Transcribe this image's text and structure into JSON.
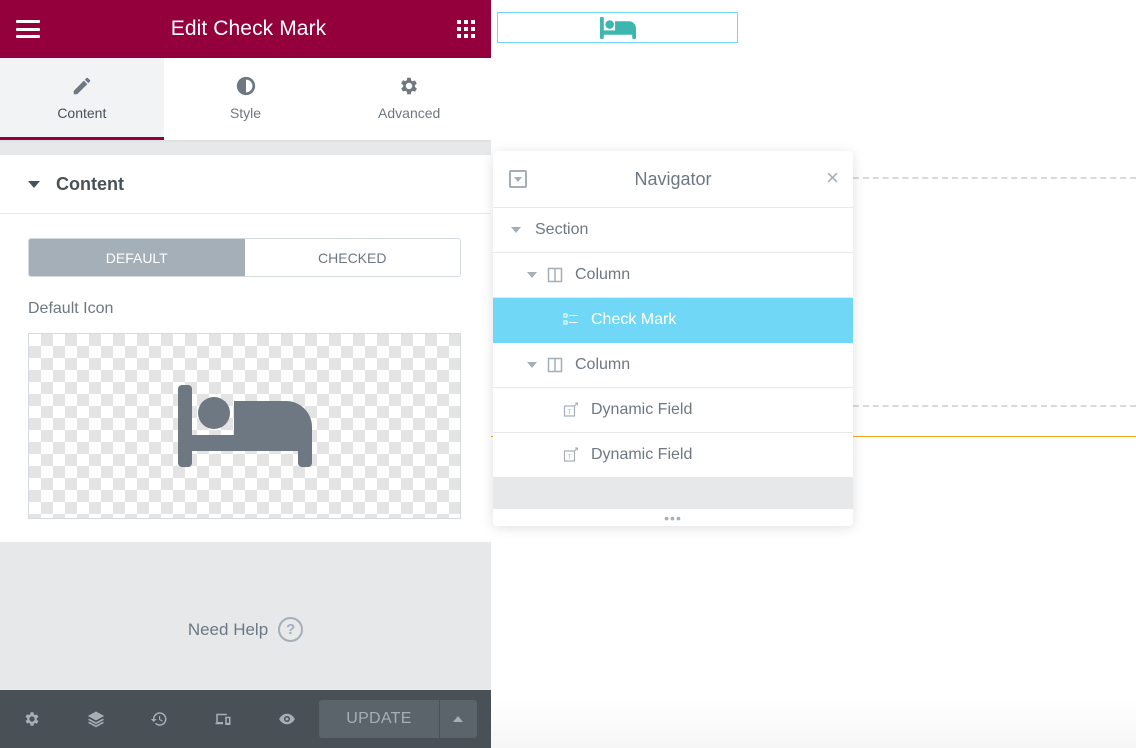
{
  "panel": {
    "title": "Edit Check Mark",
    "brand_color": "#93003c",
    "tabs": [
      {
        "label": "Content",
        "icon": "pencil-icon",
        "active": true
      },
      {
        "label": "Style",
        "icon": "half-circle-icon",
        "active": false
      },
      {
        "label": "Advanced",
        "icon": "gear-icon",
        "active": false
      }
    ],
    "section_title": "Content",
    "states": [
      {
        "label": "DEFAULT",
        "active": true
      },
      {
        "label": "CHECKED",
        "active": false
      }
    ],
    "icon_label": "Default Icon",
    "selected_icon": "bed-icon",
    "help_label": "Need Help",
    "help_glyph": "?",
    "footer": {
      "icons": [
        "gear-icon",
        "layers-icon",
        "history-icon",
        "responsive-icon",
        "eye-icon"
      ],
      "update_label": "UPDATE"
    }
  },
  "canvas": {
    "widget_icon": "bed-icon",
    "accent_color": "#71d7f7"
  },
  "navigator": {
    "title": "Navigator",
    "close_glyph": "×",
    "items": [
      {
        "label": "Section",
        "type": "section",
        "depth": 0
      },
      {
        "label": "Column",
        "type": "column",
        "depth": 1
      },
      {
        "label": "Check Mark",
        "type": "widget",
        "depth": 2,
        "selected": true
      },
      {
        "label": "Column",
        "type": "column",
        "depth": 1
      },
      {
        "label": "Dynamic Field",
        "type": "widget",
        "depth": 2
      },
      {
        "label": "Dynamic Field",
        "type": "widget",
        "depth": 2
      }
    ],
    "resize_glyph": "•••"
  }
}
